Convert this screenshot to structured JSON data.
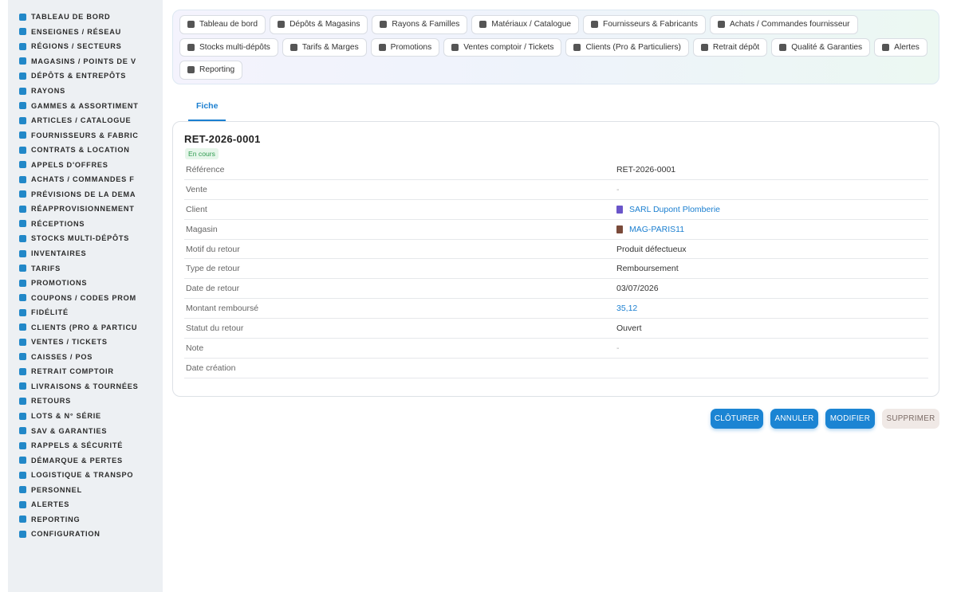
{
  "sidebar": {
    "items": [
      {
        "label": "TABLEAU DE BORD",
        "icon": "dashboard-icon"
      },
      {
        "label": "ENSEIGNES / RÉSEAU",
        "icon": "flag-icon"
      },
      {
        "label": "RÉGIONS / SECTEURS",
        "icon": "map-icon"
      },
      {
        "label": "MAGASINS / POINTS DE V",
        "icon": "store-icon"
      },
      {
        "label": "DÉPÔTS & ENTREPÔTS",
        "icon": "warehouse-icon"
      },
      {
        "label": "RAYONS",
        "icon": "shelf-icon"
      },
      {
        "label": "GAMMES & ASSORTIMENT",
        "icon": "box-icon"
      },
      {
        "label": "ARTICLES / CATALOGUE",
        "icon": "catalog-icon"
      },
      {
        "label": "FOURNISSEURS & FABRIC",
        "icon": "truck-icon"
      },
      {
        "label": "CONTRATS & LOCATION",
        "icon": "contract-icon"
      },
      {
        "label": "APPELS D'OFFRES",
        "icon": "gavel-icon"
      },
      {
        "label": "ACHATS / COMMANDES F",
        "icon": "cart-icon"
      },
      {
        "label": "PRÉVISIONS DE LA DEMA",
        "icon": "chart-icon"
      },
      {
        "label": "RÉAPPROVISIONNEMENT",
        "icon": "refresh-icon"
      },
      {
        "label": "RÉCEPTIONS",
        "icon": "dolly-icon"
      },
      {
        "label": "STOCKS MULTI-DÉPÔTS",
        "icon": "boxes-icon"
      },
      {
        "label": "INVENTAIRES",
        "icon": "clipboard-icon"
      },
      {
        "label": "TARIFS",
        "icon": "tag-icon"
      },
      {
        "label": "PROMOTIONS",
        "icon": "percent-icon"
      },
      {
        "label": "COUPONS / CODES PROM",
        "icon": "ticket-icon"
      },
      {
        "label": "FIDÉLITÉ",
        "icon": "card-icon"
      },
      {
        "label": "CLIENTS (PRO & PARTICU",
        "icon": "user-icon"
      },
      {
        "label": "VENTES / TICKETS",
        "icon": "receipt-icon"
      },
      {
        "label": "CAISSES / POS",
        "icon": "cash-register-icon"
      },
      {
        "label": "RETRAIT COMPTOIR",
        "icon": "car-icon"
      },
      {
        "label": "LIVRAISONS & TOURNÉES",
        "icon": "delivery-icon"
      },
      {
        "label": "RETOURS",
        "icon": "undo-icon"
      },
      {
        "label": "LOTS & N° SÉRIE",
        "icon": "barcode-icon"
      },
      {
        "label": "SAV & GARANTIES",
        "icon": "tools-icon"
      },
      {
        "label": "RAPPELS & SÉCURITÉ",
        "icon": "warning-icon"
      },
      {
        "label": "DÉMARQUE & PERTES",
        "icon": "trash-icon"
      },
      {
        "label": "LOGISTIQUE & TRANSPO",
        "icon": "route-icon"
      },
      {
        "label": "PERSONNEL",
        "icon": "users-icon"
      },
      {
        "label": "ALERTES",
        "icon": "bell-icon"
      },
      {
        "label": "REPORTING",
        "icon": "pie-icon"
      },
      {
        "label": "CONFIGURATION",
        "icon": "gear-icon"
      }
    ]
  },
  "topnav": {
    "rows": [
      [
        {
          "label": "Tableau de bord",
          "icon": "dashboard-icon"
        },
        {
          "label": "Dépôts & Magasins",
          "icon": "warehouse-icon"
        },
        {
          "label": "Rayons & Familles",
          "icon": "basket-icon"
        },
        {
          "label": "Matériaux / Catalogue",
          "icon": "catalog-icon"
        },
        {
          "label": "Fournisseurs & Fabricants",
          "icon": "truck-icon"
        },
        {
          "label": "Achats / Commandes fournisseur",
          "icon": "cart-icon"
        }
      ],
      [
        {
          "label": "Stocks multi-dépôts",
          "icon": "boxes-icon"
        },
        {
          "label": "Tarifs & Marges",
          "icon": "tag-icon"
        },
        {
          "label": "Promotions",
          "icon": "percent-icon"
        },
        {
          "label": "Ventes comptoir / Tickets",
          "icon": "receipt-icon"
        },
        {
          "label": "Clients (Pro & Particuliers)",
          "icon": "user-icon"
        },
        {
          "label": "Retrait dépôt",
          "icon": "car-icon"
        },
        {
          "label": "Qualité & Garanties",
          "icon": "check-icon"
        },
        {
          "label": "Alertes",
          "icon": "bell-icon"
        }
      ],
      [
        {
          "label": "Reporting",
          "icon": "pie-icon"
        }
      ]
    ]
  },
  "tabs": {
    "fiche": "Fiche"
  },
  "record": {
    "title": "RET-2026-0001",
    "status_badge": "En cours",
    "fields": [
      {
        "key": "Référence",
        "value": "RET-2026-0001",
        "kind": "text"
      },
      {
        "key": "Vente",
        "value": "-",
        "kind": "muted"
      },
      {
        "key": "Client",
        "value": "SARL Dupont Plomberie",
        "kind": "link",
        "icon": "building-icon"
      },
      {
        "key": "Magasin",
        "value": "MAG-PARIS11",
        "kind": "link",
        "icon": "store-icon"
      },
      {
        "key": "Motif du retour",
        "value": "Produit défectueux",
        "kind": "text"
      },
      {
        "key": "Type de retour",
        "value": "Remboursement",
        "kind": "text"
      },
      {
        "key": "Date de retour",
        "value": "03/07/2026",
        "kind": "text"
      },
      {
        "key": "Montant remboursé",
        "value": "35,12",
        "kind": "link"
      },
      {
        "key": "Statut du retour",
        "value": "Ouvert",
        "kind": "text"
      },
      {
        "key": "Note",
        "value": "-",
        "kind": "muted"
      },
      {
        "key": "Date création",
        "value": "",
        "kind": "text"
      }
    ]
  },
  "actions": {
    "cloturer": "CLÔTURER",
    "annuler": "ANNULER",
    "modifier": "MODIFIER",
    "supprimer": "SUPPRIMER"
  },
  "colors": {
    "accent": "#1b84d3",
    "badge_bg": "#e6f6ea",
    "badge_text": "#2e9b4f",
    "sidebar_bg": "#edf0f3"
  }
}
